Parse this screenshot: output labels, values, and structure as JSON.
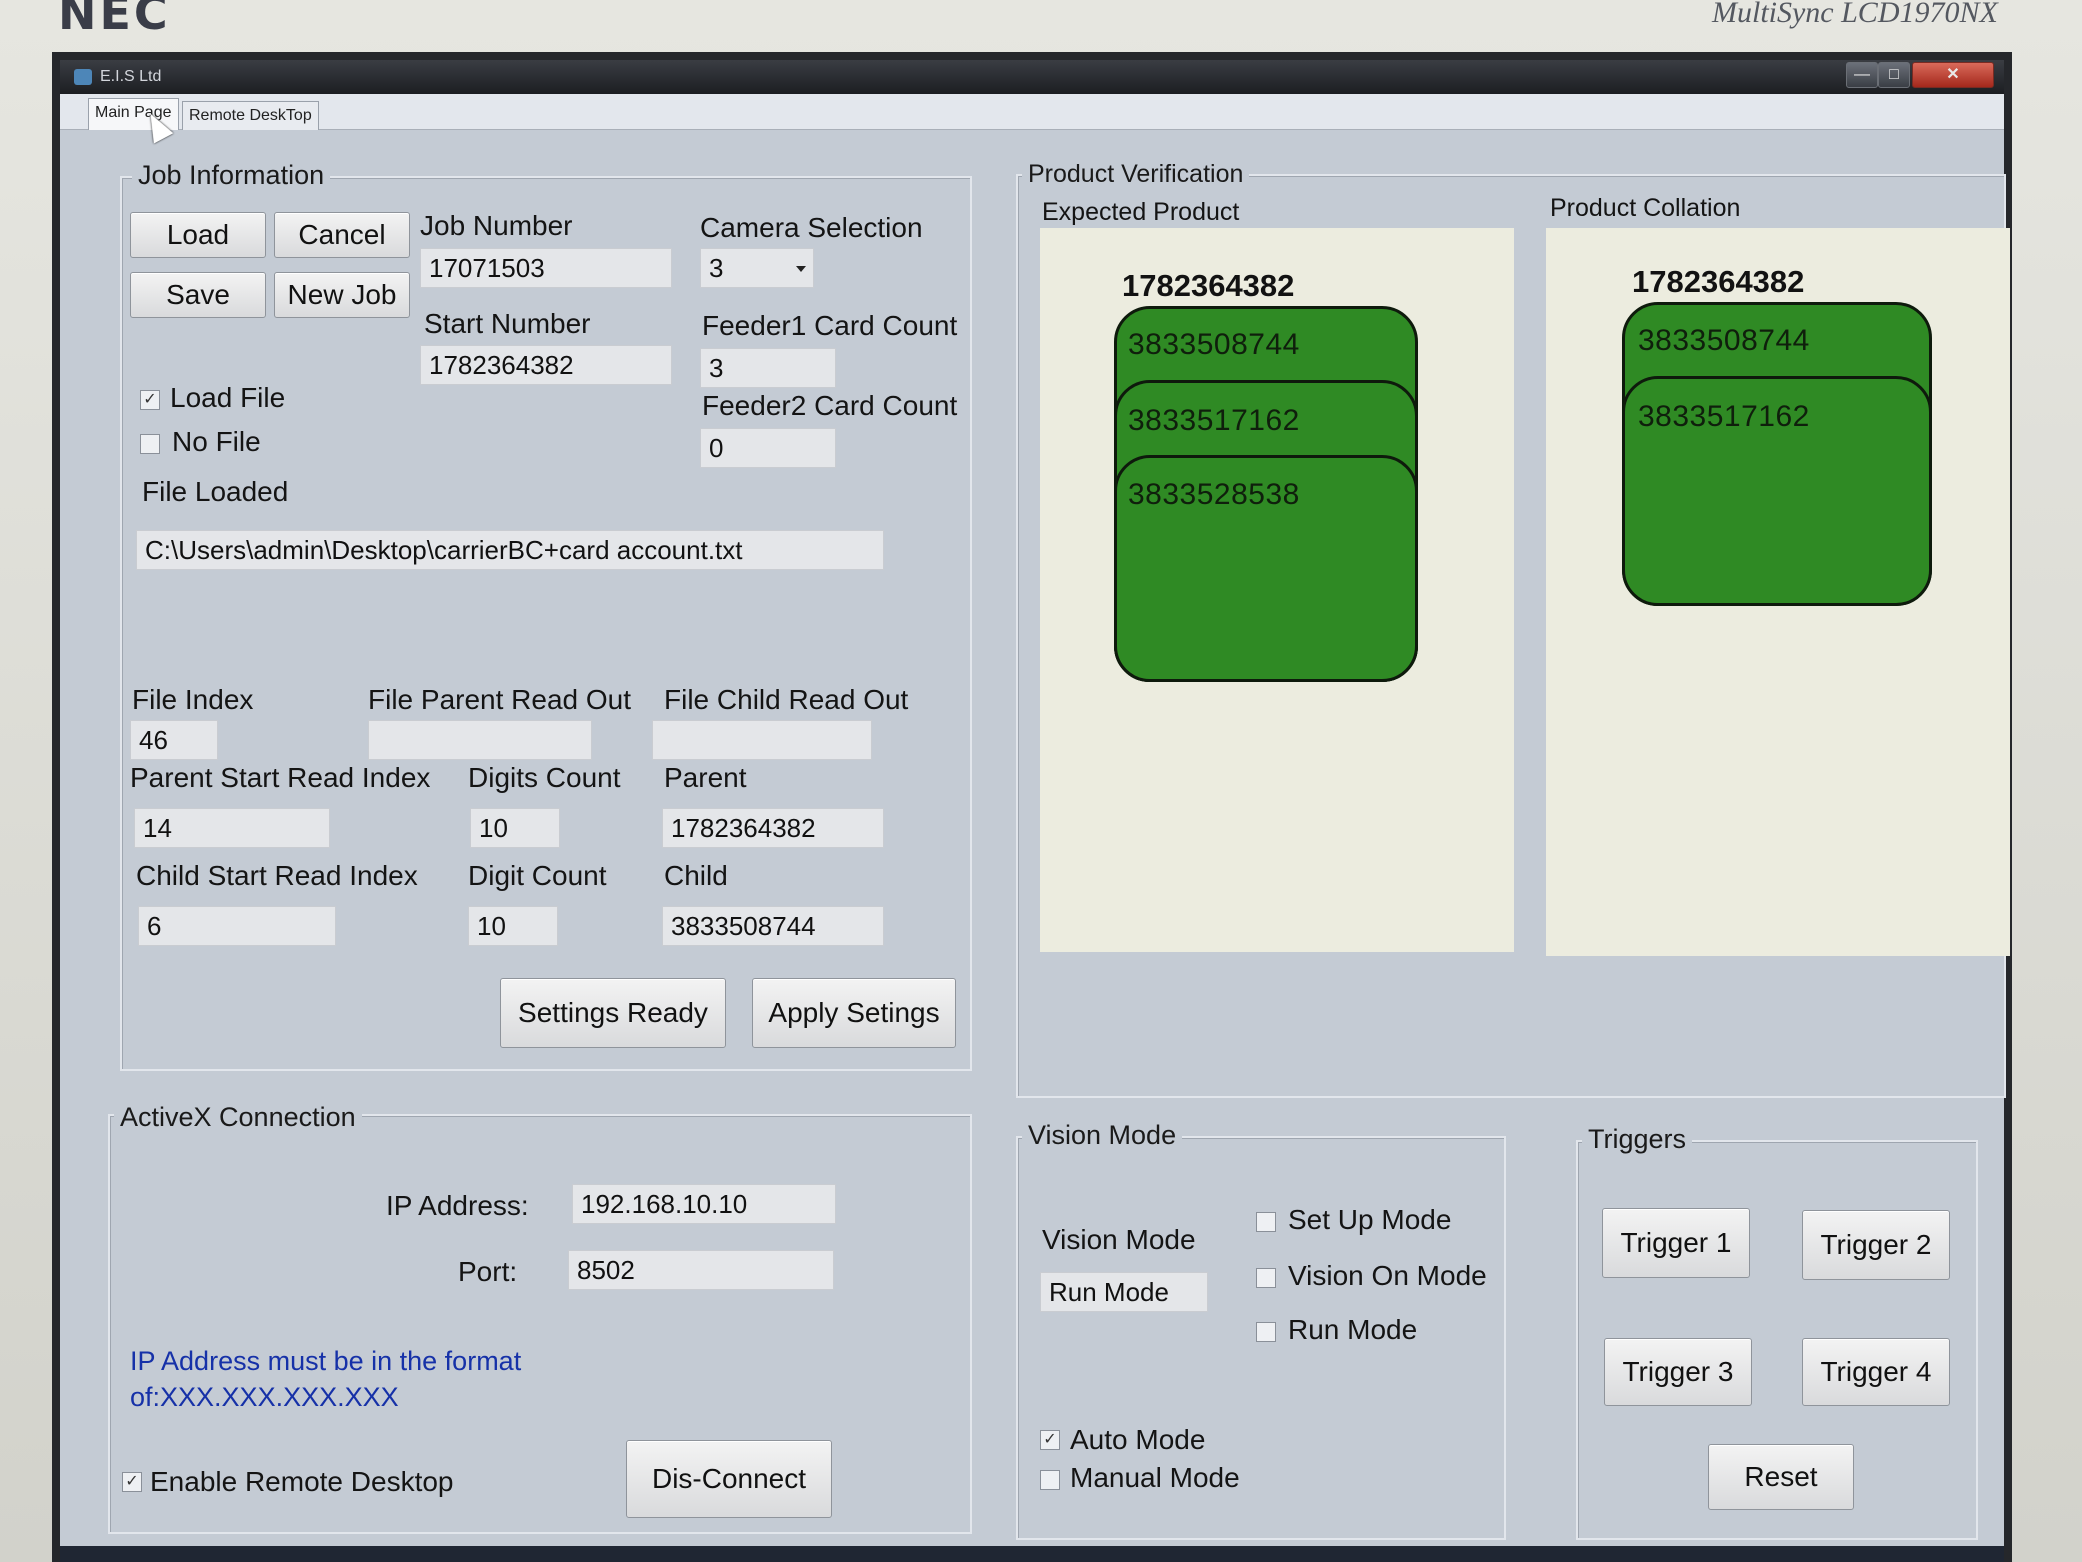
{
  "monitor": {
    "brand": "NEC",
    "model": "MultiSync LCD1970NX"
  },
  "window": {
    "title": "E.I.S Ltd",
    "close_label": "✕",
    "max_label": "□",
    "min_label": "—"
  },
  "tabs": [
    {
      "label": "Main Page",
      "active": true
    },
    {
      "label": "Remote DeskTop",
      "active": false
    }
  ],
  "job_information": {
    "legend": "Job Information",
    "load_label": "Load",
    "cancel_label": "Cancel",
    "save_label": "Save",
    "new_job_label": "New Job",
    "job_number_label": "Job Number",
    "job_number": "17071503",
    "camera_selection_label": "Camera Selection",
    "camera_selection": "3",
    "start_number_label": "Start Number",
    "start_number": "1782364382",
    "feeder1_label": "Feeder1 Card Count",
    "feeder1": "3",
    "feeder2_label": "Feeder2 Card Count",
    "feeder2": "0",
    "load_file_label": "Load File",
    "load_file_checked": true,
    "no_file_label": "No File",
    "no_file_checked": false,
    "file_loaded_label": "File Loaded",
    "file_loaded": "C:\\Users\\admin\\Desktop\\carrierBC+card account.txt",
    "file_index_label": "File Index",
    "file_index": "46",
    "file_parent_read_out_label": "File Parent Read Out",
    "file_parent_read_out": "",
    "file_child_read_out_label": "File Child Read Out",
    "file_child_read_out": "",
    "parent_start_read_index_label": "Parent Start Read Index",
    "parent_start_read_index": "14",
    "digits_count_label": "Digits Count",
    "digits_count": "10",
    "parent_label": "Parent",
    "parent": "1782364382",
    "child_start_read_index_label": "Child Start Read Index",
    "child_start_read_index": "6",
    "digit_count_label": "Digit Count",
    "digit_count": "10",
    "child_label": "Child",
    "child": "3833508744",
    "settings_ready_label": "Settings Ready",
    "apply_settings_label": "Apply Setings"
  },
  "activex": {
    "legend": "ActiveX Connection",
    "ip_label": "IP Address:",
    "ip_value": "192.168.10.10",
    "port_label": "Port:",
    "port_value": "8502",
    "hint_line1": "IP Address must be in the format",
    "hint_line2": "of:XXX.XXX.XXX.XXX",
    "enable_remote_label": "Enable Remote Desktop",
    "enable_remote_checked": true,
    "disconnect_label": "Dis-Connect"
  },
  "product_verification": {
    "legend": "Product Verification",
    "expected_label": "Expected Product",
    "collation_label": "Product Collation",
    "expected_parent": "1782364382",
    "expected_children": [
      "3833508744",
      "3833517162",
      "3833528538"
    ],
    "collation_parent": "1782364382",
    "collation_children": [
      "3833508744",
      "3833517162"
    ],
    "card_color": "#2f8a24"
  },
  "vision_mode": {
    "legend": "Vision Mode",
    "label": "Vision Mode",
    "value": "Run Mode",
    "setup_label": "Set Up Mode",
    "vision_on_label": "Vision On Mode",
    "run_label": "Run Mode",
    "auto_label": "Auto Mode",
    "auto_checked": true,
    "manual_label": "Manual Mode",
    "manual_checked": false
  },
  "triggers": {
    "legend": "Triggers",
    "trigger1": "Trigger 1",
    "trigger2": "Trigger 2",
    "trigger3": "Trigger 3",
    "trigger4": "Trigger 4",
    "reset": "Reset"
  }
}
